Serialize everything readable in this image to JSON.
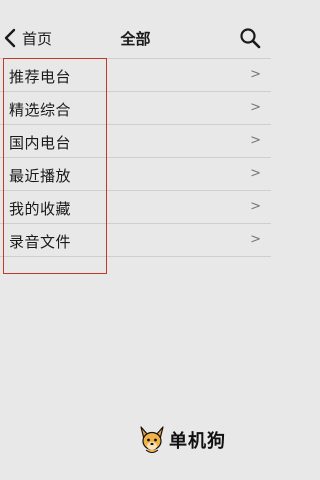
{
  "header": {
    "back_label": "首页",
    "title": "全部",
    "back_icon": "chevron-left-icon",
    "search_icon": "search-icon"
  },
  "menu": {
    "items": [
      {
        "label": "推荐电台",
        "arrow": ">"
      },
      {
        "label": "精选综合",
        "arrow": ">"
      },
      {
        "label": "国内电台",
        "arrow": ">"
      },
      {
        "label": "最近播放",
        "arrow": ">"
      },
      {
        "label": "我的收藏",
        "arrow": ">"
      },
      {
        "label": "录音文件",
        "arrow": ">"
      }
    ]
  },
  "annotation": {
    "highlight_color": "#c0392b"
  },
  "watermark": {
    "text": "单机狗",
    "logo_icon": "dog-logo-icon"
  }
}
